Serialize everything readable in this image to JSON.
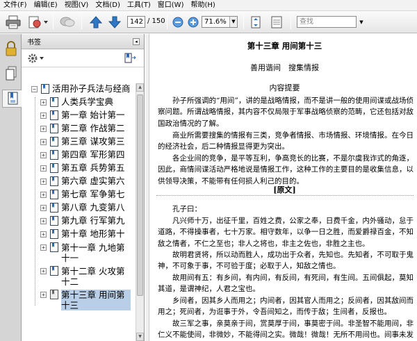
{
  "menu": [
    "文件(F)",
    "编辑(E)",
    "视图(V)",
    "文档(D)",
    "工具(T)",
    "窗口(W)",
    "帮助(H)"
  ],
  "toolbar": {
    "current_page": "142",
    "total_pages": "/ 150",
    "zoom": "71.6%",
    "search_placeholder": "查找"
  },
  "bookmarks": {
    "header": "书签",
    "root": "活用孙子兵法与经商",
    "items": [
      {
        "label": "人类兵学宝典",
        "selected": false
      },
      {
        "label": "第一章 始计第一",
        "selected": false
      },
      {
        "label": "第二章 作战第二",
        "selected": false
      },
      {
        "label": "第三章 谋攻第三",
        "selected": false
      },
      {
        "label": "第四章 军形第四",
        "selected": false
      },
      {
        "label": "第五章 兵势第五",
        "selected": false
      },
      {
        "label": "第六章 虚实第六",
        "selected": false
      },
      {
        "label": "第七章 军争第七",
        "selected": false
      },
      {
        "label": "第八章 九变第八",
        "selected": false
      },
      {
        "label": "第九章 行军第九",
        "selected": false
      },
      {
        "label": "第十章 地形第十",
        "selected": false
      },
      {
        "label": "第十一章 九地第十一",
        "selected": false
      },
      {
        "label": "第十二章 火攻第十二",
        "selected": false
      },
      {
        "label": "第十三章 用间第十三",
        "selected": true
      }
    ]
  },
  "document": {
    "chapter_title": "第十三章 用间第十三",
    "subtitle": "善用谐间　搜集情报",
    "section_head": "内容提要",
    "summary": [
      "孙子所强调的“用间”，讲的是战略情报，而不是讲一般的使用间谍或战场侦察问题。所谓战略情报，其内容不仅局限于军事战略侦察的范畴，它还包括对敌国政治情况的了解。",
      "商业所需要搜集的情报有三类，竞争者情报、市场情报、环境情报。在今日的经济社会，后二种情报显得更为突出。",
      "各企业间的竞争，是平等互利，争高竞长的比赛，不是尔虞我诈式的角逐，因此，商情间谍活动严格地说是情报工作，这种工作的主要目的是收集信息，以供领导决策，不能带有任何损人利己的目的。"
    ],
    "original_head": "[原文]",
    "original": [
      "孔子曰：",
      "凡兴师十万，出征千里，百姓之费，公家之奉，日费千金，内外骚动，怠于道路，不得操事者，七十万家。相守数年，以争一日之胜，而爱爵禄百金，不知敌之情者，不仁之至也；非人之将也，非主之佐也，非胜之主也。",
      "故明君贤将，所以动而胜人，成功出于众者，先知也。先知者，不可取于鬼神，不可象于事，不可验于度；必取于人，知敌之情也。",
      "故用间有五：有乡间，有内间，有反间，有死间，有生间。五间俱起，莫知其道，是谓神纪，人君之宝也。",
      "乡间者，因其乡人而用之；内间者，因其官人而用之；反间者，因其敌间而用之；死间者，为诳事于外，令吾间知之，而传于敌；生间者，反报也。",
      "故三军之事，亲莫亲于间，赏莫厚于间，事莫密于间。非圣智不能用间，非仁义不能使间，非微妙，不能得间之实。微哉！微哉！无所不用间也。间事未发而先闻者，间与所告者皆死。"
    ]
  }
}
